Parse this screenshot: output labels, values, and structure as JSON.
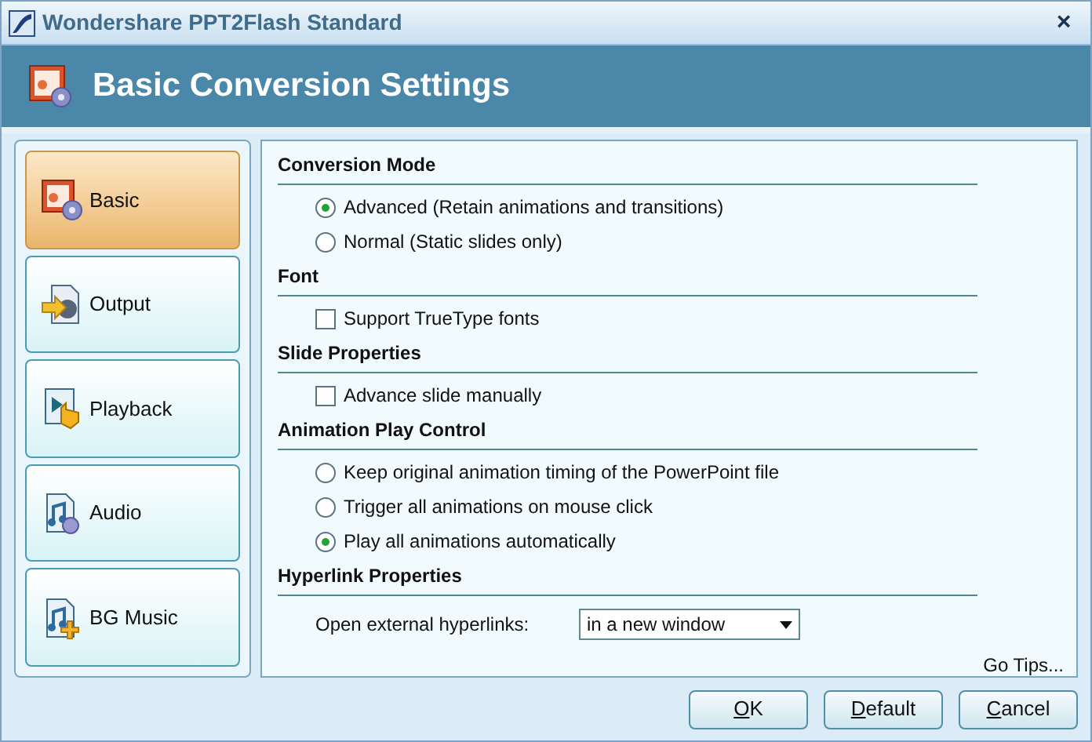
{
  "window": {
    "title": "Wondershare PPT2Flash Standard",
    "close": "×"
  },
  "header": {
    "title": "Basic Conversion Settings"
  },
  "sidebar": {
    "items": [
      {
        "label": "Basic",
        "selected": true
      },
      {
        "label": "Output",
        "selected": false
      },
      {
        "label": "Playback",
        "selected": false
      },
      {
        "label": "Audio",
        "selected": false
      },
      {
        "label": "BG Music",
        "selected": false
      }
    ]
  },
  "sections": [
    {
      "title": "Conversion Mode",
      "items": [
        {
          "kind": "radio",
          "label": "Advanced (Retain animations and transitions)",
          "selected": true
        },
        {
          "kind": "radio",
          "label": "Normal (Static slides only)",
          "selected": false
        }
      ]
    },
    {
      "title": "Font",
      "items": [
        {
          "kind": "checkbox",
          "label": "Support TrueType fonts",
          "checked": false
        }
      ]
    },
    {
      "title": "Slide Properties",
      "items": [
        {
          "kind": "checkbox",
          "label": "Advance slide manually",
          "checked": false
        }
      ]
    },
    {
      "title": "Animation Play Control",
      "items": [
        {
          "kind": "radio",
          "label": "Keep original animation timing of the PowerPoint file",
          "selected": false
        },
        {
          "kind": "radio",
          "label": "Trigger all animations on mouse click",
          "selected": false
        },
        {
          "kind": "radio",
          "label": "Play all animations automatically",
          "selected": true
        }
      ]
    },
    {
      "title": "Hyperlink Properties",
      "items": [
        {
          "kind": "dropdown",
          "label": "Open external hyperlinks:",
          "value": "in a new window"
        }
      ]
    }
  ],
  "tips_link": "Go Tips...",
  "buttons": [
    "OK",
    "Default",
    "Cancel"
  ]
}
